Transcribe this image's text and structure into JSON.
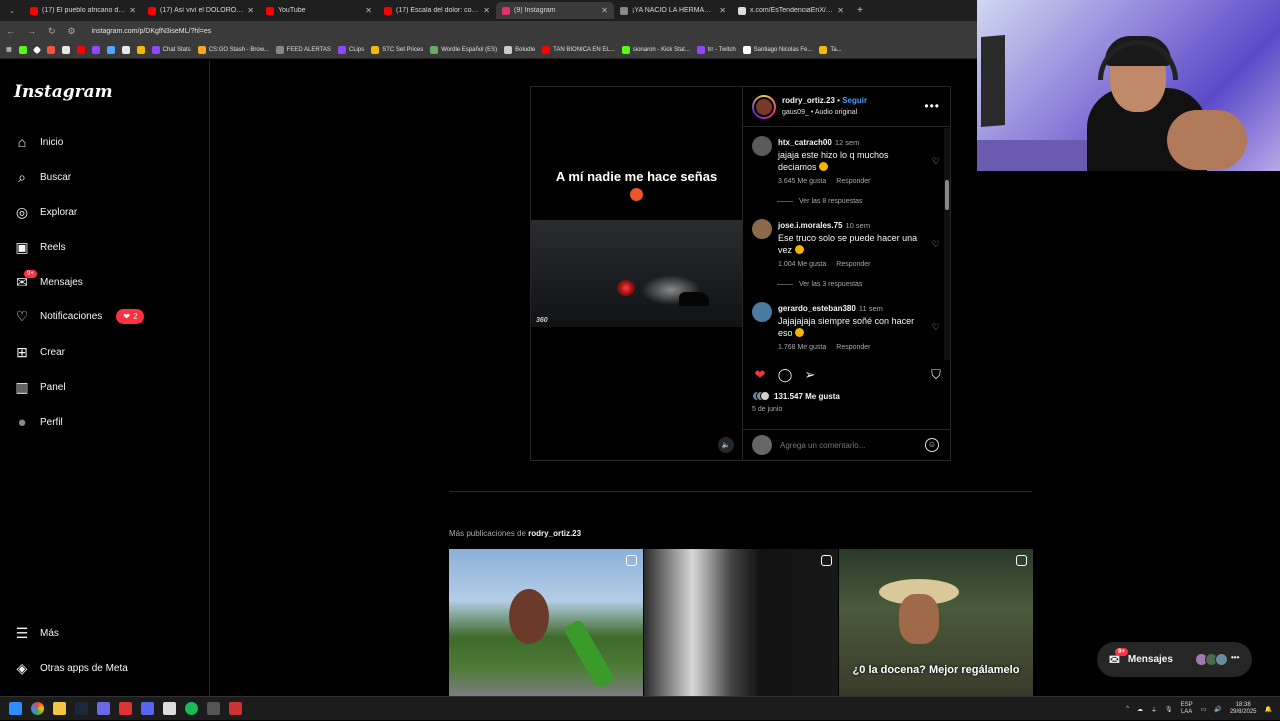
{
  "browser": {
    "tabs": [
      {
        "title": "(17) El pueblo africano donde ...",
        "color": "#ff0000",
        "active": false
      },
      {
        "title": "(17) Así viví el DOLOROSO RITU...",
        "color": "#ff0000",
        "active": false
      },
      {
        "title": "YouTube",
        "color": "#ff0000",
        "active": false
      },
      {
        "title": "(17) Escala del dolor: compara...",
        "color": "#ff0000",
        "active": false
      },
      {
        "title": "(9) Instagram",
        "color": "#e1306c",
        "active": true
      },
      {
        "title": "¡YA NACIÓ LA HERMANA DE F...",
        "color": "#888888",
        "active": false
      },
      {
        "title": "x.com/EsTendenciaEnX/statu...",
        "color": "#dddddd",
        "active": false
      }
    ],
    "url": "instagram.com/p/DKgfN3iseML/?hl=es",
    "bookmarks": [
      {
        "label": "Chat Stats",
        "color": "#9147ff"
      },
      {
        "label": "CS:GO Stash - Brow...",
        "color": "#f5a623"
      },
      {
        "label": "FEED ALERTAS",
        "color": "#888888"
      },
      {
        "label": "CLips",
        "color": "#9147ff"
      },
      {
        "label": "STC Set Prices",
        "color": "#f0b90b"
      },
      {
        "label": "Wordle Español (ES)",
        "color": "#6aaa64"
      },
      {
        "label": "Boludle",
        "color": "#cccccc"
      },
      {
        "label": "TAN BIONICA EN EL...",
        "color": "#ff0000"
      },
      {
        "label": "sionaron - Kick Stat...",
        "color": "#53fc18"
      },
      {
        "label": "trr - Twitch",
        "color": "#9147ff"
      },
      {
        "label": "Santiago Nicolas Fe...",
        "color": "#ffffff"
      },
      {
        "label": "Ta...",
        "color": "#f0b90b"
      }
    ]
  },
  "sidebar": {
    "logo": "Instagram",
    "items": [
      {
        "label": "Inicio",
        "icon": "home-icon"
      },
      {
        "label": "Buscar",
        "icon": "search-icon"
      },
      {
        "label": "Explorar",
        "icon": "compass-icon"
      },
      {
        "label": "Reels",
        "icon": "reels-icon"
      },
      {
        "label": "Mensajes",
        "icon": "messenger-icon",
        "badge": "9+"
      },
      {
        "label": "Notificaciones",
        "icon": "heart-icon",
        "pill": "2"
      },
      {
        "label": "Crear",
        "icon": "plus-square-icon"
      },
      {
        "label": "Panel",
        "icon": "chart-icon"
      },
      {
        "label": "Perfil",
        "icon": "avatar-icon"
      }
    ],
    "bottom": [
      {
        "label": "Más",
        "icon": "menu-icon"
      },
      {
        "label": "Otras apps de Meta",
        "icon": "meta-apps-icon"
      }
    ]
  },
  "post": {
    "overlay_text": "A mí nadie me hace señas",
    "video_watermark": "360",
    "username": "rodry_ortiz.23",
    "follow_label": "Seguir",
    "audio": "gaus09_ • Audio original",
    "comments": [
      {
        "user": "htx_catrach00",
        "time": "12 sem",
        "text": "jajaja este hizo lo q muchos deciamos",
        "likes": "3.645 Me gusta",
        "reply": "Responder",
        "replies": "Ver las 8 respuestas"
      },
      {
        "user": "jose.i.morales.75",
        "time": "10 sem",
        "text": "Ese truco solo se puede hacer una vez",
        "likes": "1.004 Me gusta",
        "reply": "Responder",
        "replies": "Ver las 3 respuestas"
      },
      {
        "user": "gerardo_esteban380",
        "time": "11 sem",
        "text": "Jajajajaja siempre soñé con hacer eso",
        "likes": "1.768 Me gusta",
        "reply": "Responder",
        "replies": ""
      }
    ],
    "like_count": "131.547 Me gusta",
    "date": "5 de junio",
    "comment_placeholder": "Agrega un comentario..."
  },
  "more_posts": {
    "prefix": "Más publicaciones de",
    "username": "rodry_ortiz.23",
    "thumb3_caption": "¿0 la docena? Mejor regálamelo"
  },
  "messages_pill": {
    "label": "Mensajes",
    "badge": "9+"
  },
  "taskbar": {
    "lang_top": "ESP",
    "lang_bottom": "LAA",
    "time": "18:38",
    "date": "29/8/2025"
  }
}
